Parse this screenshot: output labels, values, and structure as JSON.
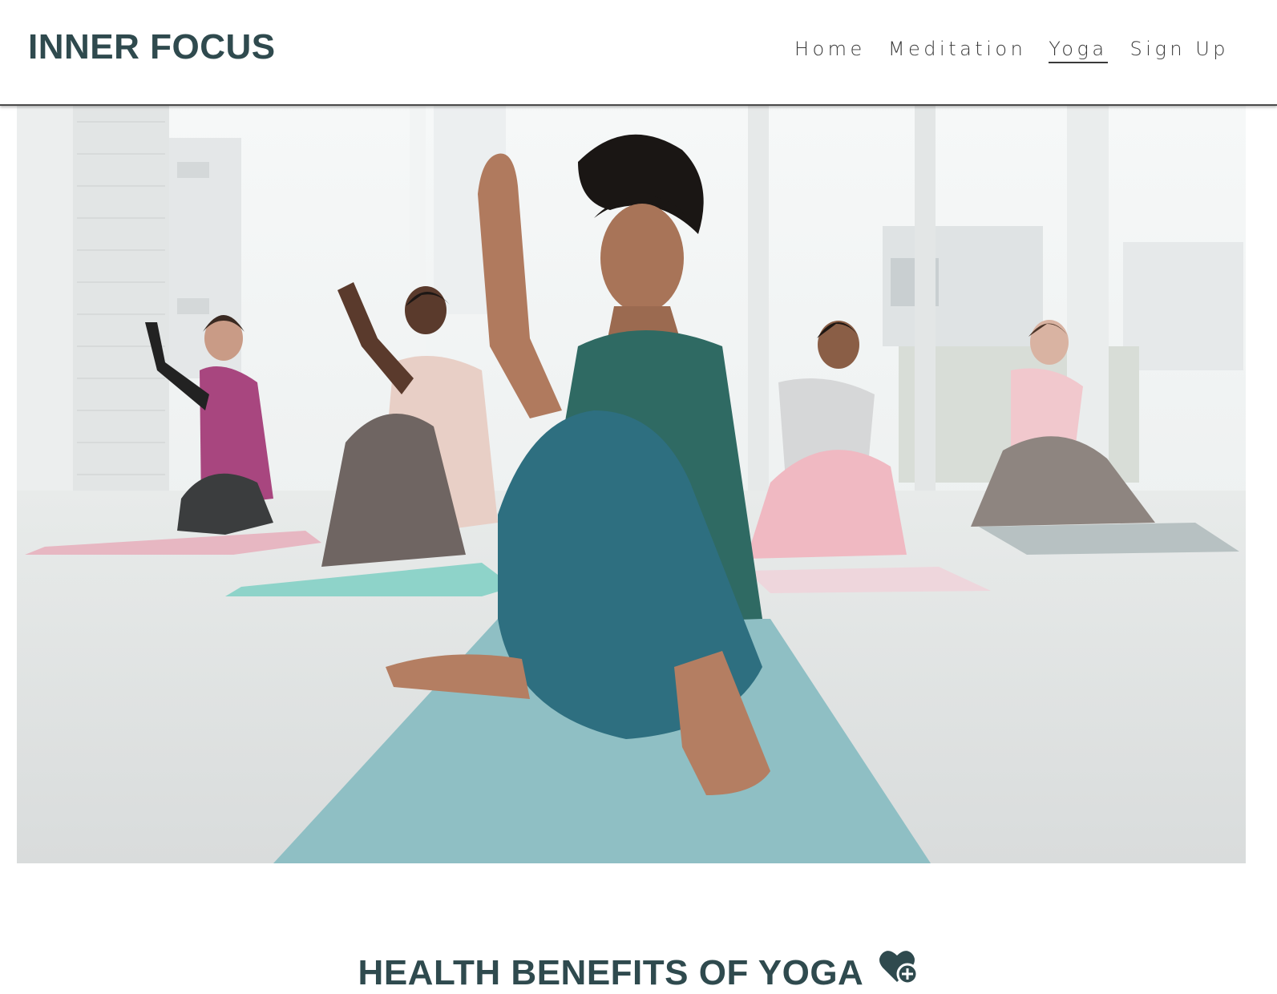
{
  "site": {
    "logo": "INNER FOCUS"
  },
  "nav": {
    "items": [
      {
        "label": "Home",
        "active": false
      },
      {
        "label": "Meditation",
        "active": false
      },
      {
        "label": "Yoga",
        "active": true
      },
      {
        "label": "Sign Up",
        "active": false
      }
    ]
  },
  "hero": {
    "icon": "yoga-class-photo"
  },
  "section": {
    "title": "HEALTH BENEFITS OF YOGA",
    "icon": "heart-plus-icon"
  },
  "colors": {
    "brand": "#2f4a4e",
    "nav_text": "#3a3a3a"
  }
}
